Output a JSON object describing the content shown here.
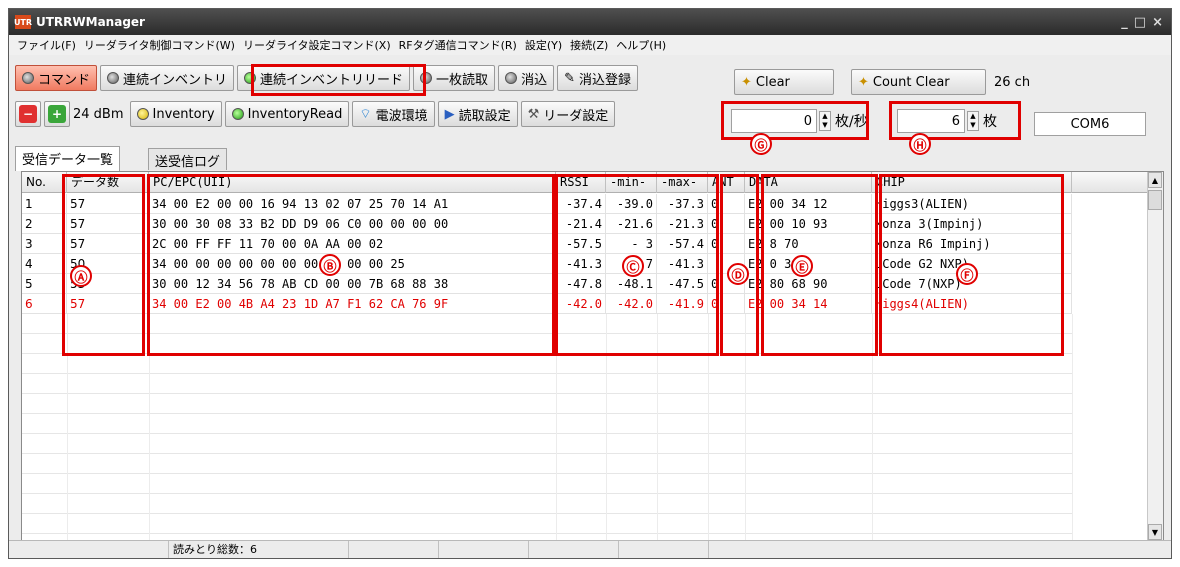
{
  "window": {
    "title": "UTRRWManager",
    "icon_label": "UTR",
    "controls": [
      "_",
      "□",
      "×"
    ]
  },
  "menu": [
    "ファイル(F)",
    "リーダライタ制御コマンド(W)",
    "リーダライタ設定コマンド(X)",
    "RFタグ通信コマンド(R)",
    "設定(Y)",
    "接続(Z)",
    "ヘルプ(H)"
  ],
  "toolbar1": {
    "command": "コマンド",
    "continuous_inventory": "連続インベントリ",
    "continuous_inventory_read": "連続インベントリリード",
    "single_read": "一枚読取",
    "erase": "消込",
    "erase_register": "消込登録"
  },
  "toolbar2": {
    "power": "24 dBm",
    "inventory": "Inventory",
    "inventory_read": "InventoryRead",
    "radio_env": "電波環境",
    "read_settings": "読取設定",
    "reader_settings": "リーダ設定"
  },
  "right_panel": {
    "clear": "Clear",
    "count_clear": "Count Clear",
    "channel": "26 ch",
    "rate_value": "0",
    "rate_unit": "枚/秒",
    "count_value": "6",
    "count_unit": "枚",
    "port": "COM6"
  },
  "tabs": [
    "受信データ一覧",
    "送受信ログ"
  ],
  "grid": {
    "columns": [
      "No.",
      "データ数",
      "PC/EPC(UII)",
      "RSSI",
      "-min-",
      "-max-",
      "ANT",
      "DATA",
      "CHIP"
    ],
    "rows": [
      {
        "no": "1",
        "count": "57",
        "epc": "34 00 E2 00 00 16 94 13 02 07 25 70 14 A1",
        "rssi": "-37.4",
        "min": "-39.0",
        "max": "-37.3",
        "ant": "0",
        "data": "E2 00 34 12",
        "chip": "Higgs3(ALIEN)"
      },
      {
        "no": "2",
        "count": "57",
        "epc": "30 00 30 08 33 B2 DD D9 06 C0 00 00 00 00",
        "rssi": "-21.4",
        "min": "-21.6",
        "max": "-21.3",
        "ant": "0",
        "data": "E2 00 10 93",
        "chip": "Monza 3(Impinj)"
      },
      {
        "no": "3",
        "count": "57",
        "epc": "2C 00 FF FF 11 70 00    0A AA 00 02",
        "rssi": "-57.5",
        "min": "-  3",
        "max": "-57.4",
        "ant": "0",
        "data": "E2 8     70",
        "chip": "Monza R6    Impinj)"
      },
      {
        "no": "4",
        "count": "50",
        "epc": "34 00 00 00 00 00    00 00 00 00 00 25",
        "rssi": "-41.3",
        "min": "-   7",
        "max": "-41.3",
        "ant": "",
        "data": "E2 0   3 0A",
        "chip": "UCode G2   NXP)"
      },
      {
        "no": "5",
        "count": "53",
        "epc": "30 00 12 34 56 78 AB CD 00 00 7B 68 88 38",
        "rssi": "-47.8",
        "min": "-48.1",
        "max": "-47.5",
        "ant": "0",
        "data": "E2 80 68 90",
        "chip": "UCode 7(NXP)"
      },
      {
        "no": "6",
        "count": "57",
        "epc": "34 00 E2 00 4B A4 23 1D A7 F1 62 CA 76 9F",
        "rssi": "-42.0",
        "min": "-42.0",
        "max": "-41.9",
        "ant": "0",
        "data": "E2 00 34 14",
        "chip": "Higgs4(ALIEN)"
      }
    ]
  },
  "markers": [
    "Ⓐ",
    "Ⓑ",
    "Ⓒ",
    "Ⓓ",
    "Ⓔ",
    "Ⓕ",
    "Ⓖ",
    "Ⓗ"
  ],
  "status": {
    "total_read": "読みとり総数：6"
  },
  "colors": {
    "annotation_red": "#e00000",
    "titlebar": "#3a3a3a",
    "highlight_row_text": "#e00000"
  }
}
